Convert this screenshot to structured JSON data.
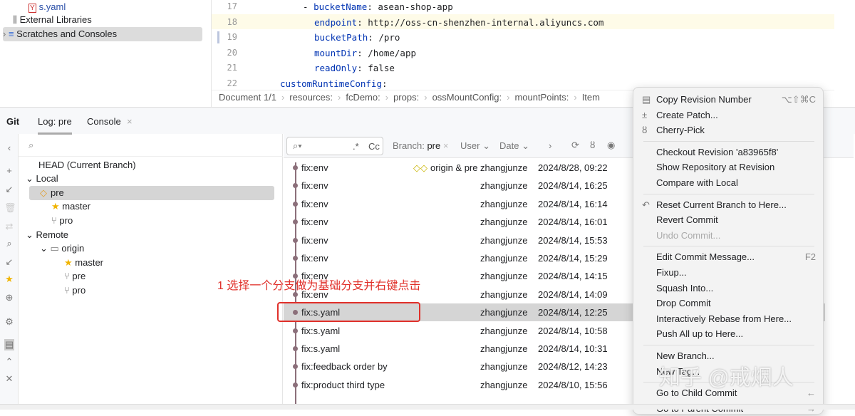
{
  "project_tree": {
    "items": [
      {
        "label": "s.yaml",
        "icon": "yaml-file-icon"
      },
      {
        "label": "External Libraries",
        "icon": "library-icon"
      },
      {
        "label": "Scratches and Consoles",
        "icon": "scratches-icon"
      }
    ]
  },
  "editor": {
    "lines": [
      {
        "num": "17",
        "text": "  - bucketName: asean-shop-app",
        "key": "bucketName",
        "val": ": asean-shop-app",
        "indent": "- "
      },
      {
        "num": "18",
        "key": "endpoint",
        "val": ": http://oss-cn-shenzhen-internal.aliyuncs.com"
      },
      {
        "num": "19",
        "key": "bucketPath",
        "val": ": /pro"
      },
      {
        "num": "20",
        "key": "mountDir",
        "val": ": /home/app"
      },
      {
        "num": "21",
        "key": "readOnly",
        "val": ": false"
      },
      {
        "num": "22",
        "key": "customRuntimeConfig",
        "val": ":"
      }
    ],
    "breadcrumb": [
      "Document 1/1",
      "resources:",
      "fcDemo:",
      "props:",
      "ossMountConfig:",
      "mountPoints:",
      "Item"
    ]
  },
  "git_panel": {
    "title": "Git",
    "tabs": [
      "Log: pre",
      "Console"
    ]
  },
  "branches": {
    "head": "HEAD (Current Branch)",
    "local_label": "Local",
    "local": [
      "pre",
      "master",
      "pro"
    ],
    "remote_label": "Remote",
    "origin": "origin",
    "remote": [
      "master",
      "pre",
      "pro"
    ]
  },
  "log": {
    "filters": {
      "regex": ".*",
      "case": "Cc",
      "branch_label": "Branch:",
      "branch_value": "pre",
      "user": "User",
      "date": "Date"
    },
    "commits": [
      {
        "msg": "fix:env",
        "refs": "origin & pre",
        "author": "zhangjunze",
        "date": "2024/8/28, 09:22"
      },
      {
        "msg": "fix:env",
        "author": "zhangjunze",
        "date": "2024/8/14, 16:25"
      },
      {
        "msg": "fix:env",
        "author": "zhangjunze",
        "date": "2024/8/14, 16:14"
      },
      {
        "msg": "fix:env",
        "author": "zhangjunze",
        "date": "2024/8/14, 16:01"
      },
      {
        "msg": "fix:env",
        "author": "zhangjunze",
        "date": "2024/8/14, 15:53"
      },
      {
        "msg": "fix:env",
        "author": "zhangjunze",
        "date": "2024/8/14, 15:29"
      },
      {
        "msg": "fix:env",
        "author": "zhangjunze",
        "date": "2024/8/14, 14:15"
      },
      {
        "msg": "fix:env",
        "author": "zhangjunze",
        "date": "2024/8/14, 14:09"
      },
      {
        "msg": "fix:s.yaml",
        "author": "zhangjunze",
        "date": "2024/8/14, 12:25"
      },
      {
        "msg": "fix:s.yaml",
        "author": "zhangjunze",
        "date": "2024/8/14, 10:58"
      },
      {
        "msg": "fix:s.yaml",
        "author": "zhangjunze",
        "date": "2024/8/14, 10:31"
      },
      {
        "msg": "fix:feedback order by",
        "author": "zhangjunze",
        "date": "2024/8/12, 14:23"
      },
      {
        "msg": "fix:product third type",
        "author": "zhangjunze",
        "date": "2024/8/10, 15:56"
      }
    ],
    "selected_index": 8
  },
  "annotation": {
    "text": "1 选择一个分支做为基础分支并右键点击",
    "color": "#e0302a"
  },
  "context_menu": {
    "groups": [
      [
        {
          "label": "Copy Revision Number",
          "shortcut": "⌥⇧⌘C",
          "icon": "copy-icon"
        },
        {
          "label": "Create Patch...",
          "icon": "patch-icon"
        },
        {
          "label": "Cherry-Pick",
          "icon": "cherry-icon"
        }
      ],
      [
        {
          "label": "Checkout Revision 'a83965f8'"
        },
        {
          "label": "Show Repository at Revision"
        },
        {
          "label": "Compare with Local"
        }
      ],
      [
        {
          "label": "Reset Current Branch to Here...",
          "icon": "reset-icon"
        },
        {
          "label": "Revert Commit"
        },
        {
          "label": "Undo Commit...",
          "disabled": true
        }
      ],
      [
        {
          "label": "Edit Commit Message...",
          "shortcut": "F2"
        },
        {
          "label": "Fixup..."
        },
        {
          "label": "Squash Into..."
        },
        {
          "label": "Drop Commit"
        },
        {
          "label": "Interactively Rebase from Here..."
        },
        {
          "label": "Push All up to Here..."
        }
      ],
      [
        {
          "label": "New Branch..."
        },
        {
          "label": "New Tag..."
        }
      ],
      [
        {
          "label": "Go to Child Commit",
          "shortcut": "←"
        },
        {
          "label": "Go to Parent Commit",
          "shortcut": "→"
        }
      ]
    ]
  },
  "watermark": "知乎 @戒烟人"
}
